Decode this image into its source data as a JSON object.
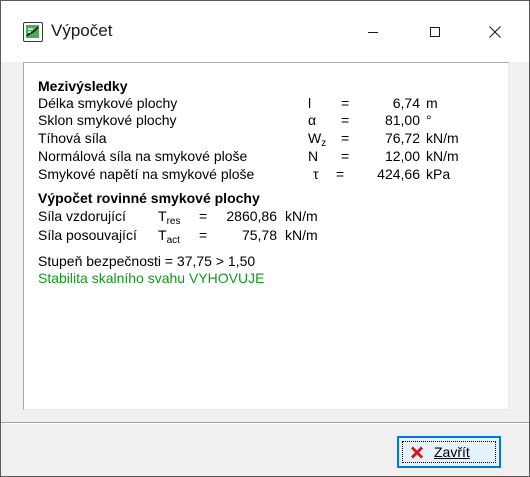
{
  "window": {
    "title": "Výpočet",
    "icon": "calculation-app-icon"
  },
  "titlebar_buttons": {
    "minimize": "minimize-icon",
    "maximize": "maximize-icon",
    "close": "close-icon"
  },
  "intermediate": {
    "heading": "Mezivýsledky",
    "rows": [
      {
        "label": "Délka smykové plochy",
        "symbol": "l",
        "eq": "=",
        "value": "6,74",
        "unit": "m"
      },
      {
        "label": "Sklon smykové plochy",
        "symbol": "α",
        "eq": "=",
        "value": "81,00",
        "unit": "°"
      },
      {
        "label": "Tíhová síla",
        "symbol": "W",
        "symbol_sub": "z",
        "eq": "=",
        "value": "76,72",
        "unit": "kN/m"
      },
      {
        "label": "Normálová síla na smykové ploše",
        "symbol": "N",
        "eq": "=",
        "value": "12,00",
        "unit": "kN/m"
      },
      {
        "label": "Smykové napětí na smykové ploše",
        "symbol": "τ",
        "eq": "=",
        "value": "424,66",
        "unit": "kPa"
      }
    ]
  },
  "planar": {
    "heading": "Výpočet rovinné smykové plochy",
    "rows": [
      {
        "label": "Síla vzdorující",
        "symbol": "T",
        "symbol_sub": "res",
        "eq": "=",
        "value": "2860,86",
        "unit": "kN/m"
      },
      {
        "label": "Síla posouvající",
        "symbol": "T",
        "symbol_sub": "act",
        "eq": "=",
        "value": "75,78",
        "unit": "kN/m"
      }
    ]
  },
  "safety": {
    "text": "Stupeň bezpečnosti = 37,75 > 1,50",
    "verdict": "Stabilita skalního svahu VYHOVUJE",
    "verdict_color": "#129a1c"
  },
  "footer": {
    "close_label": "Zavřít",
    "close_icon": "red-x-icon",
    "accent": "#0078d7"
  }
}
